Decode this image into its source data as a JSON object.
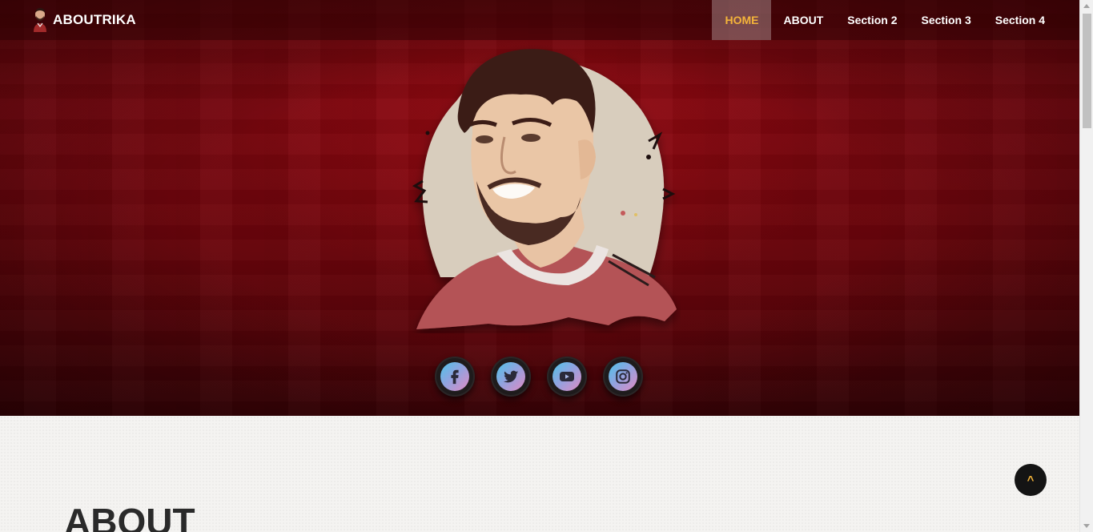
{
  "brand": {
    "name": "ABOUTRIKA",
    "avatar_icon": "player-avatar-icon"
  },
  "nav": {
    "items": [
      {
        "label": "HOME",
        "active": true
      },
      {
        "label": "ABOUT",
        "active": false
      },
      {
        "label": "Section 2",
        "active": false
      },
      {
        "label": "Section 3",
        "active": false
      },
      {
        "label": "Section 4",
        "active": false
      }
    ],
    "active_color": "#f4b43a"
  },
  "hero": {
    "portrait_icon": "player-portrait-illustration",
    "social": [
      {
        "name": "facebook-icon"
      },
      {
        "name": "twitter-icon"
      },
      {
        "name": "youtube-icon"
      },
      {
        "name": "instagram-icon"
      }
    ]
  },
  "about": {
    "heading": "ABOUT"
  },
  "back_to_top": {
    "label": "^"
  },
  "colors": {
    "hero_red": "#7d0710",
    "accent": "#f4b43a",
    "dark": "#141414"
  }
}
